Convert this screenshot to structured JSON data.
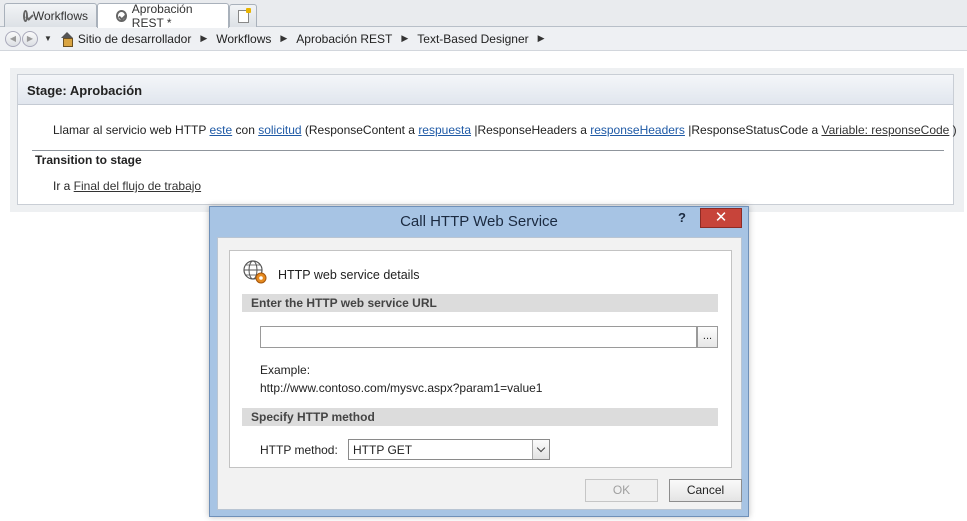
{
  "tabs": [
    {
      "label": "Workflows",
      "active": false
    },
    {
      "label": "Aprobación REST *",
      "active": true
    }
  ],
  "breadcrumb": [
    "Sitio de desarrollador",
    "Workflows",
    "Aprobación REST",
    "Text-Based Designer"
  ],
  "stage": {
    "title": "Stage: Aprobación",
    "action": {
      "t1": "Llamar al servicio web HTTP ",
      "link_este": "este",
      "t2": " con ",
      "link_solicitud": "solicitud",
      "t3": " (ResponseContent a ",
      "link_respuesta": "respuesta",
      "t4": " |ResponseHeaders a ",
      "link_responseHeaders": "responseHeaders",
      "t5": " |ResponseStatusCode a ",
      "link_variable": "Variable: responseCode",
      "t6": " )"
    },
    "transition_title": "Transition to stage",
    "transition_prefix": "Ir a ",
    "transition_link": "Final del flujo de trabajo"
  },
  "dialog": {
    "title": "Call HTTP Web Service",
    "help_label": "?",
    "close_label": "✕",
    "details_title": "HTTP web service details",
    "url_section": "Enter the HTTP web service URL",
    "url_value": "",
    "browse_label": "...",
    "example_label": "Example:",
    "example_url": "http://www.contoso.com/mysvc.aspx?param1=value1",
    "method_section": "Specify HTTP method",
    "method_label": "HTTP method:",
    "method_value": "HTTP GET",
    "ok_label": "OK",
    "cancel_label": "Cancel"
  },
  "colors": {
    "link": "#1f5aa6",
    "dialog_frame": "#a7c4e4",
    "close_button": "#c7443a"
  },
  "icons": {
    "tab_icon": "workflow-icon",
    "home": "home-icon",
    "service": "globe-gear-icon"
  }
}
